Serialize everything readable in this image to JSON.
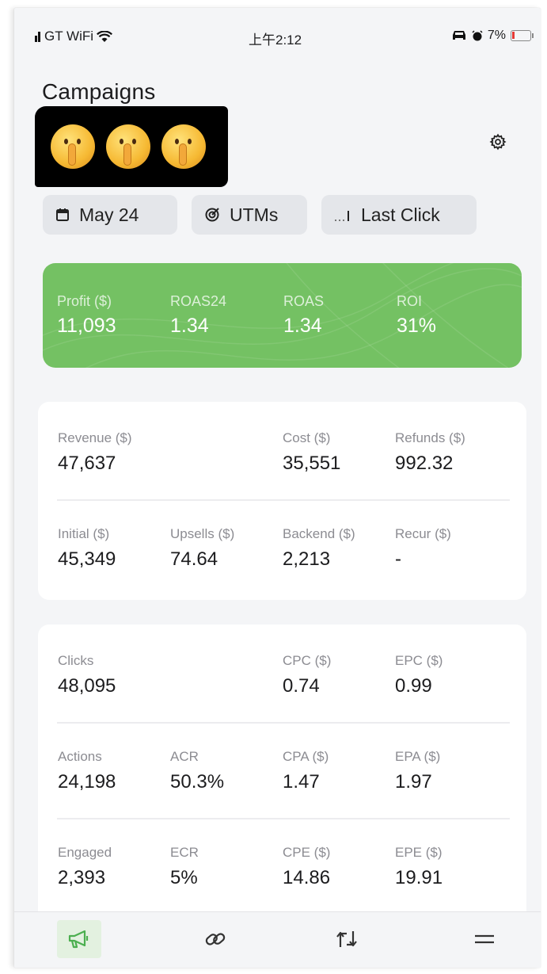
{
  "status_bar": {
    "carrier": "GT WiFi",
    "time": "上午2:12",
    "battery": "7%"
  },
  "header": {
    "title": "Campaigns"
  },
  "filters": {
    "date": "May 24",
    "utms": "UTMs",
    "attribution": "Last Click"
  },
  "summary": [
    {
      "label": "Profit ($)",
      "value": "11,093"
    },
    {
      "label": "ROAS24",
      "value": "1.34"
    },
    {
      "label": "ROAS",
      "value": "1.34"
    },
    {
      "label": "ROI",
      "value": "31%"
    }
  ],
  "revenue_card": {
    "row1": [
      {
        "label": "Revenue ($)",
        "value": "47,637"
      },
      {
        "label": "Cost ($)",
        "value": "35,551"
      },
      {
        "label": "Refunds ($)",
        "value": "992.32"
      }
    ],
    "row2": [
      {
        "label": "Initial ($)",
        "value": "45,349"
      },
      {
        "label": "Upsells ($)",
        "value": "74.64"
      },
      {
        "label": "Backend ($)",
        "value": "2,213"
      },
      {
        "label": "Recur ($)",
        "value": "-"
      }
    ]
  },
  "traffic_card": {
    "row1": [
      {
        "label": "Clicks",
        "value": "48,095"
      },
      {
        "label": "CPC ($)",
        "value": "0.74"
      },
      {
        "label": "EPC ($)",
        "value": "0.99"
      }
    ],
    "row2": [
      {
        "label": "Actions",
        "value": "24,198"
      },
      {
        "label": "ACR",
        "value": "50.3%"
      },
      {
        "label": "CPA ($)",
        "value": "1.47"
      },
      {
        "label": "EPA ($)",
        "value": "1.97"
      }
    ],
    "row3": [
      {
        "label": "Engaged",
        "value": "2,393"
      },
      {
        "label": "ECR",
        "value": "5%"
      },
      {
        "label": "CPE ($)",
        "value": "14.86"
      },
      {
        "label": "EPE ($)",
        "value": "19.91"
      }
    ]
  },
  "bottom_nav": {
    "items": [
      {
        "icon": "megaphone-icon",
        "active": true
      },
      {
        "icon": "link-icon",
        "active": false
      },
      {
        "icon": "swap-icon",
        "active": false
      },
      {
        "icon": "menu-icon",
        "active": false
      }
    ]
  },
  "colors": {
    "summary_green": "#74c163",
    "nav_active_bg": "#e3f1e0",
    "nav_active_icon": "#4caf50"
  }
}
